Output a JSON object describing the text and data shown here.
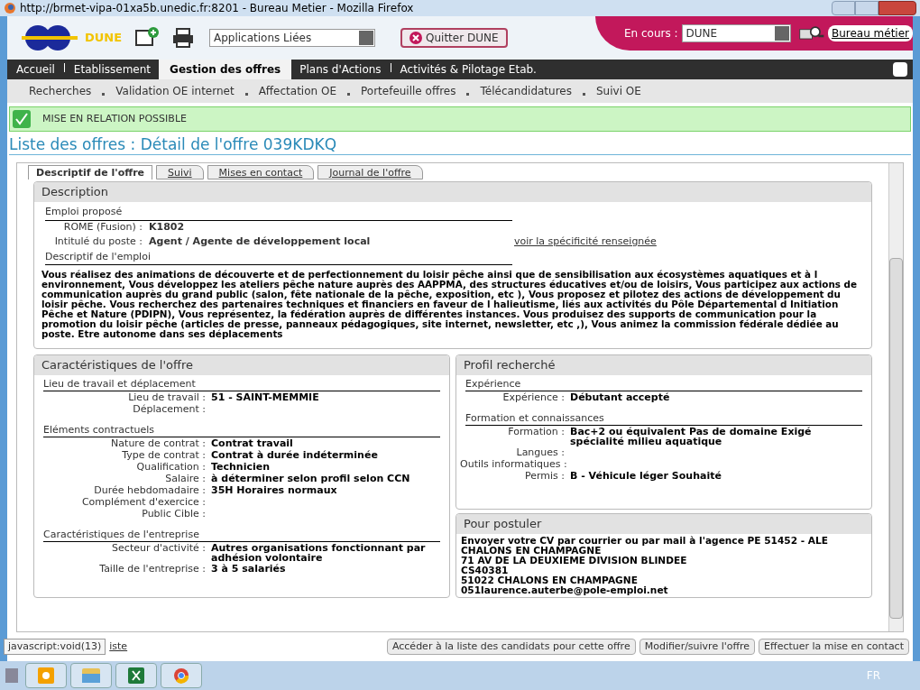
{
  "window": {
    "title": "http://brmet-vipa-01xa5b.unedic.fr:8201 - Bureau Metier - Mozilla Firefox"
  },
  "header": {
    "logo": "DUNE",
    "apps_select": "Applications Liées",
    "quit_button": "Quitter DUNE",
    "current_label": "En cours :",
    "current_select": "DUNE",
    "bureau_link": "Bureau métier"
  },
  "menu": [
    {
      "label": "Accueil",
      "selected": false
    },
    {
      "label": "Etablissement",
      "selected": false
    },
    {
      "label": "Gestion des offres",
      "selected": true
    },
    {
      "label": "Plans d'Actions",
      "selected": false
    },
    {
      "label": "Activités & Pilotage Etab.",
      "selected": false
    }
  ],
  "submenu": [
    "Recherches",
    "Validation OE internet",
    "Affectation OE",
    "Portefeuille offres",
    "Télécandidatures",
    "Suivi OE"
  ],
  "banner": "MISE EN RELATION POSSIBLE",
  "page_title": "Liste des offres : Détail de l'offre 039KDKQ",
  "tabs": [
    {
      "label": "Descriptif de l'offre",
      "selected": true
    },
    {
      "label": "Suivi",
      "selected": false
    },
    {
      "label": "Mises en contact",
      "selected": false
    },
    {
      "label": "Journal de l'offre",
      "selected": false
    }
  ],
  "description": {
    "title": "Description",
    "emploi_heading": "Emploi proposé",
    "fields": [
      {
        "label": "ROME (Fusion) :",
        "value": "K1802"
      },
      {
        "label": "Intitulé du poste :",
        "value": "Agent / Agente de développement local"
      }
    ],
    "spec_link": "voir la spécificité renseignée",
    "descriptif_heading": "Descriptif de l'emploi",
    "text": "Vous réalisez des animations de découverte et de perfectionnement du loisir pêche ainsi que de sensibilisation aux écosystèmes aquatiques et à l environnement, Vous développez les ateliers pêche nature auprès des AAPPMA, des structures éducatives et/ou de loisirs, Vous participez aux actions de communication auprès du grand public (salon, fête nationale de la pêche, exposition, etc ), Vous proposez et pilotez des actions de développement du loisir pêche. Vous recherchez des partenaires techniques et financiers en faveur de l halieutisme, liés aux activités du Pôle Départemental d Initiation Pêche et Nature (PDIPN), Vous représentez, la fédération auprès de différentes instances. Vous produisez des supports de communication pour la promotion du loisir pêche (articles de presse, panneaux pédagogiques, site internet, newsletter, etc ,), Vous animez la commission fédérale dédiée au poste. Etre autonome dans ses déplacements"
  },
  "caracteristiques": {
    "title": "Caractéristiques de l'offre",
    "sections": [
      {
        "heading": "Lieu de travail et déplacement",
        "fields": [
          {
            "label": "Lieu de travail :",
            "value": "51 - SAINT-MEMMIE"
          },
          {
            "label": "Déplacement :"
          }
        ]
      },
      {
        "heading": "Eléments contractuels",
        "fields": [
          {
            "label": "Nature de contrat :",
            "value": "Contrat travail"
          },
          {
            "label": "Type de contrat :",
            "value": "Contrat à durée indéterminée"
          },
          {
            "label": "Qualification :",
            "value": "Technicien"
          },
          {
            "label": "Salaire :",
            "value": "à déterminer selon profil selon CCN"
          },
          {
            "label": "Durée hebdomadaire :",
            "value": "35H Horaires normaux"
          },
          {
            "label": "Complément d'exercice :"
          },
          {
            "label": "Public Cible :"
          }
        ]
      },
      {
        "heading": "Caractéristiques de l'entreprise",
        "fields": [
          {
            "label": "Secteur d'activité :",
            "value": "Autres organisations fonctionnant par adhésion volontaire"
          },
          {
            "label": "Taille de l'entreprise :",
            "value": "3 à 5 salariés"
          }
        ]
      }
    ]
  },
  "profil": {
    "title": "Profil recherché",
    "sections": [
      {
        "heading": "Expérience",
        "fields": [
          {
            "label": "Expérience :",
            "value": "Débutant accepté"
          }
        ]
      },
      {
        "heading": "Formation et connaissances",
        "fields": [
          {
            "label": "Formation :",
            "value": "Bac+2 ou équivalent Pas de domaine Exigé spécialité milieu aquatique"
          },
          {
            "label": "Langues :"
          },
          {
            "label": "Outils informatiques :"
          },
          {
            "label": "Permis :",
            "value": "B - Véhicule léger Souhaité"
          }
        ]
      }
    ]
  },
  "postuler": {
    "title": "Pour postuler",
    "lines": [
      "Envoyer votre CV par courrier ou par mail à l'agence PE 51452 - ALE CHALONS EN CHAMPAGNE",
      "71 AV DE LA DEUXIEME DIVISION BLINDEE",
      "CS40381",
      "51022 CHALONS EN CHAMPAGNE",
      "051laurence.auterbe@pole-emploi.net"
    ]
  },
  "footer": {
    "back_link": "iste",
    "status_tooltip": "javascript:void(13)",
    "buttons": [
      "Accéder à la liste des candidats pour cette offre",
      "Modifier/suivre l'offre",
      "Effectuer la mise en contact"
    ]
  },
  "taskbar": {
    "language": "FR"
  }
}
